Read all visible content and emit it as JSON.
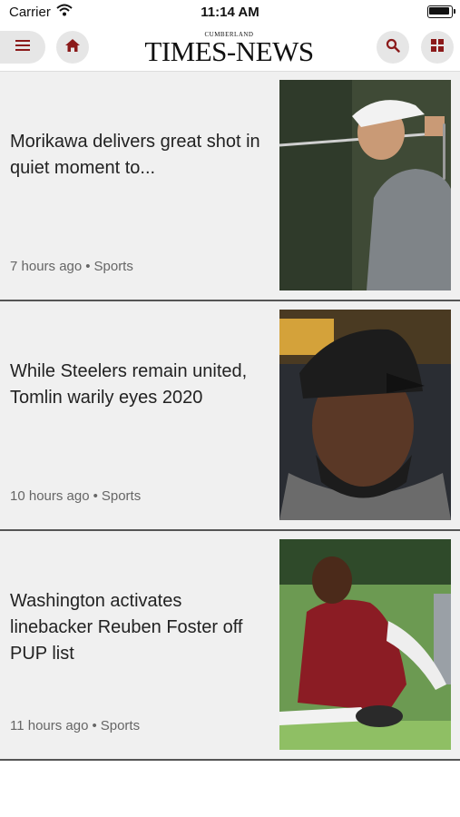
{
  "status_bar": {
    "carrier": "Carrier",
    "time": "11:14 AM"
  },
  "header": {
    "logo_small": "CUMBERLAND",
    "logo_main": "TIMES-NEWS",
    "brand_color": "#8b1a1a"
  },
  "articles": [
    {
      "headline": "Morikawa delivers great shot in quiet moment to...",
      "time": "7 hours ago",
      "separator": "•",
      "category": "Sports"
    },
    {
      "headline": "While Steelers remain united, Tomlin warily eyes 2020",
      "time": "10 hours ago",
      "separator": "•",
      "category": "Sports"
    },
    {
      "headline": "Washington activates linebacker Reuben Foster off PUP list",
      "time": "11 hours ago",
      "separator": "•",
      "category": "Sports"
    }
  ]
}
